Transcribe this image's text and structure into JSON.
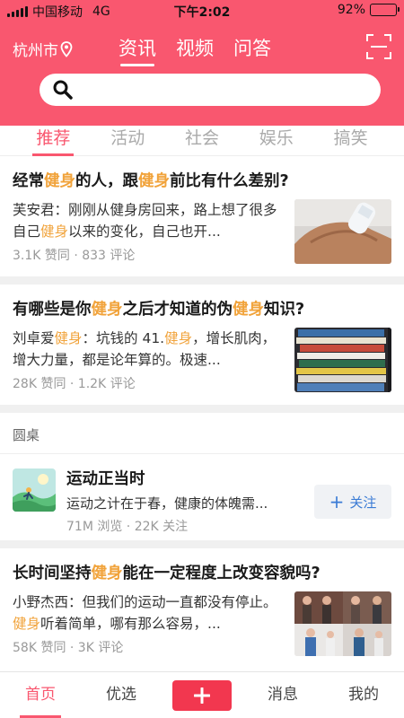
{
  "status_bar": {
    "carrier": "中国移动",
    "network": "4G",
    "time": "下午2:02",
    "battery": "92%",
    "battery_level": 0.92
  },
  "header": {
    "city": "杭州市",
    "tabs": [
      {
        "label": "资讯",
        "active": true
      },
      {
        "label": "视频",
        "active": false
      },
      {
        "label": "问答",
        "active": false
      }
    ],
    "search_placeholder": ""
  },
  "categories": [
    "推荐",
    "活动",
    "社会",
    "娱乐",
    "搞笑"
  ],
  "articles": [
    {
      "title_parts": [
        "经常",
        "健身",
        "的人，跟",
        "健身",
        "前比有什么差别?"
      ],
      "excerpt_parts": [
        "芙安君：刚刚从健身房回来，路上想了很多自己",
        "健身",
        "以来的变化，自己也开..."
      ],
      "meta": "3.1K 赞同 · 833 评论"
    },
    {
      "title_parts": [
        "有哪些是你",
        "健身",
        "之后才知道的伪",
        "健身",
        "知识?"
      ],
      "excerpt_parts": [
        "刘卓爱",
        "健身",
        "：坑钱的 41.",
        "健身",
        "，增长肌肉，增大力量，都是论年算的。极速..."
      ],
      "meta": "28K 赞同 · 1.2K 评论"
    },
    {
      "title_parts": [
        "长时间坚持",
        "健身",
        "能在一定程度上改变容貌吗?"
      ],
      "excerpt_parts": [
        "小野杰西：但我们的运动一直都没有停止。",
        "健身",
        "听着简单，哪有那么容易，..."
      ],
      "meta": "58K 赞同 · 3K 评论"
    }
  ],
  "roundtable": {
    "header": "圆桌",
    "title": "运动正当时",
    "description": "运动之计在于春，健康的体魄需...",
    "meta": "71M 浏览 · 22K 关注",
    "follow_label": "关注"
  },
  "bottom_nav": {
    "items": [
      "首页",
      "优选",
      "消息",
      "我的"
    ],
    "active_index": 0
  },
  "colors": {
    "brand": "#f9576f",
    "highlight": "#f1a33b",
    "follow": "#3a7bd5"
  }
}
